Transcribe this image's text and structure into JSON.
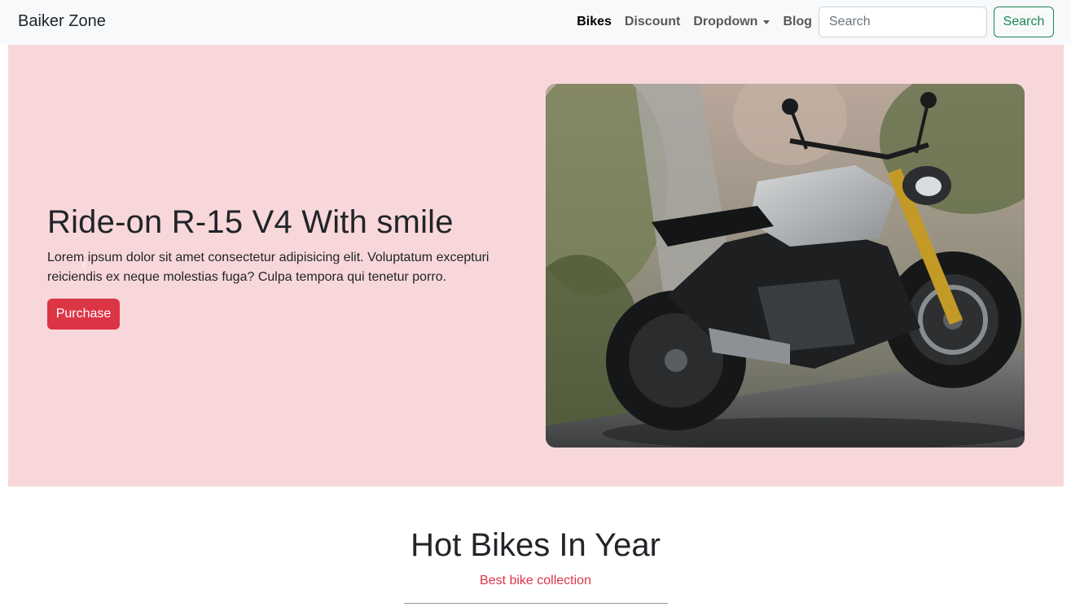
{
  "navbar": {
    "brand": "Baiker Zone",
    "links": [
      {
        "label": "Bikes",
        "active": true
      },
      {
        "label": "Discount"
      },
      {
        "label": "Dropdown"
      },
      {
        "label": "Blog"
      }
    ],
    "search": {
      "placeholder": "Search",
      "button_label": "Search"
    }
  },
  "hero": {
    "title": "Ride-on R-15 V4 With smile",
    "text": "Lorem ipsum dolor sit amet consectetur adipisicing elit. Voluptatum excepturi reiciendis ex neque molestias fuga? Culpa tempora qui tenetur porro.",
    "button_label": "Purchase",
    "prev_icon": "‹"
  },
  "section": {
    "title": "Hot Bikes In Year",
    "subtitle": "Best bike collection"
  },
  "colors": {
    "hero_bg": "#f8d7da",
    "navbar_bg": "#f8f9fa",
    "danger": "#dc3545",
    "success": "#198754"
  }
}
